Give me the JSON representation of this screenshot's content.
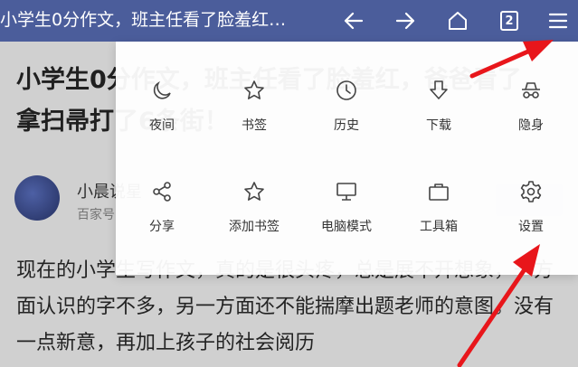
{
  "topbar": {
    "title": "小学生0分作文，班主任看了脸羞红…",
    "tab_count": "2",
    "icons": [
      "back-arrow-icon",
      "forward-arrow-icon",
      "home-icon",
      "tab-count-icon",
      "menu-icon"
    ]
  },
  "article": {
    "headline": "小学生0分作文，班主任看了脸羞红，爸爸看了，拿扫帚打了6条街！",
    "author": "小晨说星",
    "source": "百家号",
    "body": "现在的小学生写作文，真的是很头疼，总是展不开想象，一方面认识的字不多，另一方面还不能揣摩出题老师的意图。没有一点新意，再加上孩子的社会阅历"
  },
  "menu": {
    "items": [
      {
        "label": "夜间",
        "icon": "moon-icon"
      },
      {
        "label": "书签",
        "icon": "star-icon"
      },
      {
        "label": "历史",
        "icon": "clock-icon"
      },
      {
        "label": "下载",
        "icon": "download-icon"
      },
      {
        "label": "隐身",
        "icon": "incognito-icon"
      },
      {
        "label": "分享",
        "icon": "share-icon"
      },
      {
        "label": "添加书签",
        "icon": "star-outline-icon"
      },
      {
        "label": "电脑模式",
        "icon": "monitor-icon"
      },
      {
        "label": "工具箱",
        "icon": "toolbox-icon"
      },
      {
        "label": "设置",
        "icon": "gear-icon"
      }
    ]
  },
  "colors": {
    "topbar": "#4b5d9b",
    "annotation": "#e8161b"
  }
}
